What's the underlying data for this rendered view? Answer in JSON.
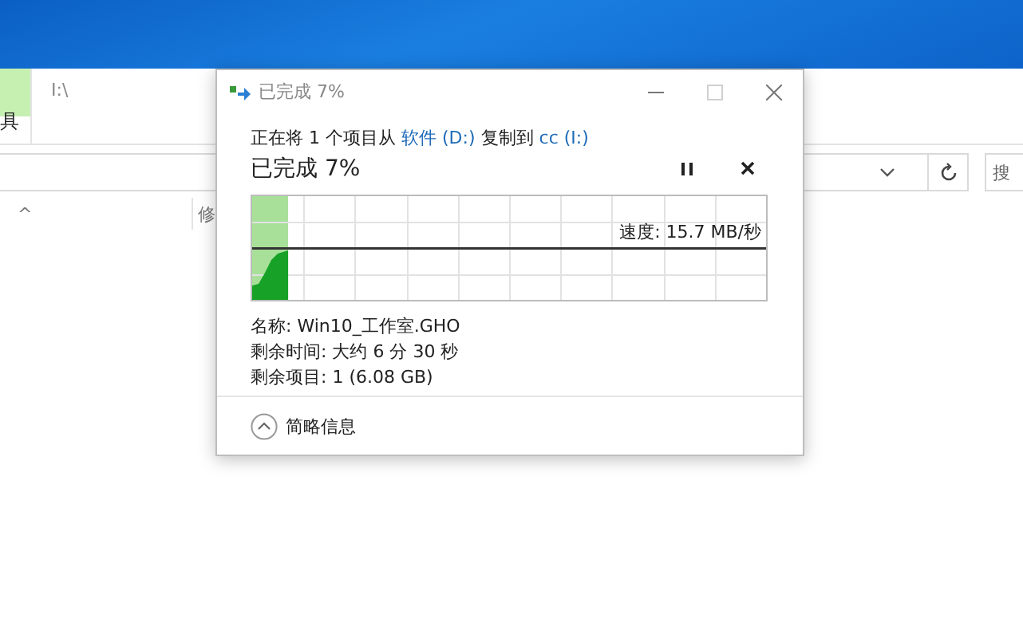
{
  "explorer": {
    "ribbon_tab": "具",
    "path": "I:\\",
    "sort_caret": "^",
    "column_1": "修",
    "search_placeholder": "搜"
  },
  "dialog": {
    "title": "已完成 7%",
    "window_controls": [
      {
        "kind": "minimize",
        "disabled": false
      },
      {
        "kind": "maximize",
        "disabled": true
      },
      {
        "kind": "close",
        "disabled": false
      }
    ],
    "description": [
      {
        "kind": "text",
        "text": "正在将 1 个项目从 "
      },
      {
        "kind": "link",
        "text": "软件 (D:)"
      },
      {
        "kind": "text",
        "text": " 复制到 "
      },
      {
        "kind": "link",
        "text": "cc (I:)"
      }
    ],
    "heading": "已完成 7%",
    "actions": [
      {
        "kind": "pause"
      },
      {
        "kind": "cancel"
      }
    ],
    "progress": {
      "level": 0.07
    },
    "speed": "速度: 15.7 MB/秒",
    "details": [
      "名称: Win10_工作室.GHO",
      "剩余时间: 大约 6 分 30 秒",
      "剩余项目: 1 (6.08 GB)"
    ],
    "toggle": {
      "label": "简略信息",
      "expanded": true
    }
  }
}
